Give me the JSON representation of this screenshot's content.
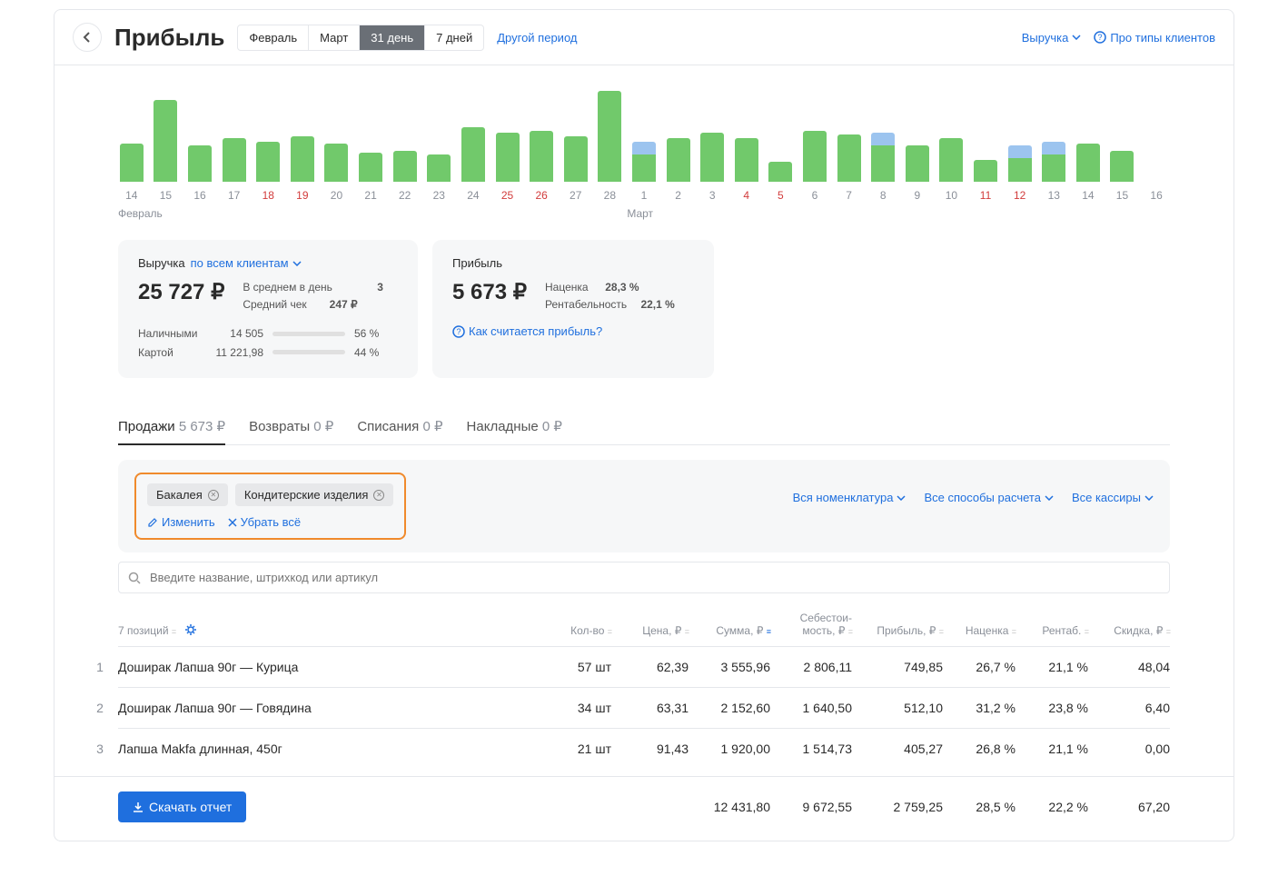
{
  "header": {
    "title": "Прибыль",
    "periods": [
      "Февраль",
      "Март",
      "31 день",
      "7 дней"
    ],
    "active_period_idx": 2,
    "other_period": "Другой период",
    "revenue_dropdown": "Выручка",
    "about_clients": "Про типы клиентов"
  },
  "chart_data": {
    "type": "bar",
    "xlabel": "",
    "ylabel": "",
    "month1": "Февраль",
    "month2": "Март",
    "bars": [
      {
        "day": "14",
        "red": false,
        "g": 42,
        "b": 0
      },
      {
        "day": "15",
        "red": false,
        "g": 90,
        "b": 0
      },
      {
        "day": "16",
        "red": false,
        "g": 40,
        "b": 0
      },
      {
        "day": "17",
        "red": false,
        "g": 48,
        "b": 0
      },
      {
        "day": "18",
        "red": true,
        "g": 44,
        "b": 0
      },
      {
        "day": "19",
        "red": true,
        "g": 50,
        "b": 0
      },
      {
        "day": "20",
        "red": false,
        "g": 42,
        "b": 0
      },
      {
        "day": "21",
        "red": false,
        "g": 32,
        "b": 0
      },
      {
        "day": "22",
        "red": false,
        "g": 34,
        "b": 0
      },
      {
        "day": "23",
        "red": false,
        "g": 30,
        "b": 0
      },
      {
        "day": "24",
        "red": false,
        "g": 60,
        "b": 0
      },
      {
        "day": "25",
        "red": true,
        "g": 54,
        "b": 0
      },
      {
        "day": "26",
        "red": true,
        "g": 56,
        "b": 0
      },
      {
        "day": "27",
        "red": false,
        "g": 50,
        "b": 0
      },
      {
        "day": "28",
        "red": false,
        "g": 100,
        "b": 0
      },
      {
        "day": "1",
        "red": false,
        "g": 30,
        "b": 14
      },
      {
        "day": "2",
        "red": false,
        "g": 48,
        "b": 0
      },
      {
        "day": "3",
        "red": false,
        "g": 54,
        "b": 0
      },
      {
        "day": "4",
        "red": true,
        "g": 48,
        "b": 0
      },
      {
        "day": "5",
        "red": true,
        "g": 22,
        "b": 0
      },
      {
        "day": "6",
        "red": false,
        "g": 56,
        "b": 0
      },
      {
        "day": "7",
        "red": false,
        "g": 52,
        "b": 0
      },
      {
        "day": "8",
        "red": false,
        "g": 40,
        "b": 14
      },
      {
        "day": "9",
        "red": false,
        "g": 40,
        "b": 0
      },
      {
        "day": "10",
        "red": false,
        "g": 48,
        "b": 0
      },
      {
        "day": "11",
        "red": true,
        "g": 24,
        "b": 0
      },
      {
        "day": "12",
        "red": true,
        "g": 26,
        "b": 14
      },
      {
        "day": "13",
        "red": false,
        "g": 30,
        "b": 14
      },
      {
        "day": "14",
        "red": false,
        "g": 42,
        "b": 0
      },
      {
        "day": "15",
        "red": false,
        "g": 34,
        "b": 0
      },
      {
        "day": "16",
        "red": false,
        "g": 0,
        "b": 0
      }
    ]
  },
  "summary": {
    "revenue": {
      "title": "Выручка",
      "filter": "по всем клиентам",
      "value": "25 727 ₽",
      "avg_day_lbl": "В среднем в день",
      "avg_day_val": "3",
      "avg_check_lbl": "Средний чек",
      "avg_check_val": "247 ₽",
      "cash_lbl": "Наличными",
      "cash_val": "14 505",
      "cash_pct": "56 %",
      "cash_pct_num": 56,
      "card_lbl": "Картой",
      "card_val": "11 221,98",
      "card_pct": "44 %",
      "card_pct_num": 44
    },
    "profit": {
      "title": "Прибыль",
      "value": "5 673 ₽",
      "markup_lbl": "Наценка",
      "markup_val": "28,3 %",
      "rent_lbl": "Рентабельность",
      "rent_val": "22,1 %",
      "help": "Как считается прибыль?"
    }
  },
  "tabs": [
    {
      "label": "Продажи",
      "amount": "5 673 ₽",
      "active": true
    },
    {
      "label": "Возвраты",
      "amount": "0 ₽",
      "active": false
    },
    {
      "label": "Списания",
      "amount": "0 ₽",
      "active": false
    },
    {
      "label": "Накладные",
      "amount": "0 ₽",
      "active": false
    }
  ],
  "filters": {
    "chips": [
      "Бакалея",
      "Кондитерские изделия"
    ],
    "edit": "Изменить",
    "clear": "Убрать всё",
    "all_nomenclature": "Вся номенклатура",
    "all_methods": "Все способы расчета",
    "all_cashiers": "Все кассиры",
    "search_placeholder": "Введите название, штрихкод или артикул"
  },
  "table": {
    "count_label": "7 позиций",
    "headers": {
      "qty": "Кол-во",
      "price": "Цена, ₽",
      "sum": "Сумма, ₽",
      "cost": "Себестои-\nмость, ₽",
      "profit": "Прибыль, ₽",
      "markup": "Наценка",
      "rent": "Рентаб.",
      "disc": "Скидка, ₽"
    },
    "rows": [
      {
        "idx": "1",
        "name": "Доширак Лапша 90г — Курица",
        "qty": "57 шт",
        "price": "62,39",
        "sum": "3 555,96",
        "cost": "2 806,11",
        "profit": "749,85",
        "markup": "26,7 %",
        "rent": "21,1 %",
        "disc": "48,04"
      },
      {
        "idx": "2",
        "name": "Доширак Лапша 90г — Говядина",
        "qty": "34 шт",
        "price": "63,31",
        "sum": "2 152,60",
        "cost": "1 640,50",
        "profit": "512,10",
        "markup": "31,2 %",
        "rent": "23,8 %",
        "disc": "6,40"
      },
      {
        "idx": "3",
        "name": "Лапша Makfa длинная, 450г",
        "qty": "21 шт",
        "price": "91,43",
        "sum": "1 920,00",
        "cost": "1 514,73",
        "profit": "405,27",
        "markup": "26,8 %",
        "rent": "21,1 %",
        "disc": "0,00"
      }
    ],
    "totals": {
      "sum": "12 431,80",
      "cost": "9 672,55",
      "profit": "2 759,25",
      "markup": "28,5 %",
      "rent": "22,2 %",
      "disc": "67,20"
    }
  },
  "footer": {
    "download": "Скачать отчет"
  }
}
